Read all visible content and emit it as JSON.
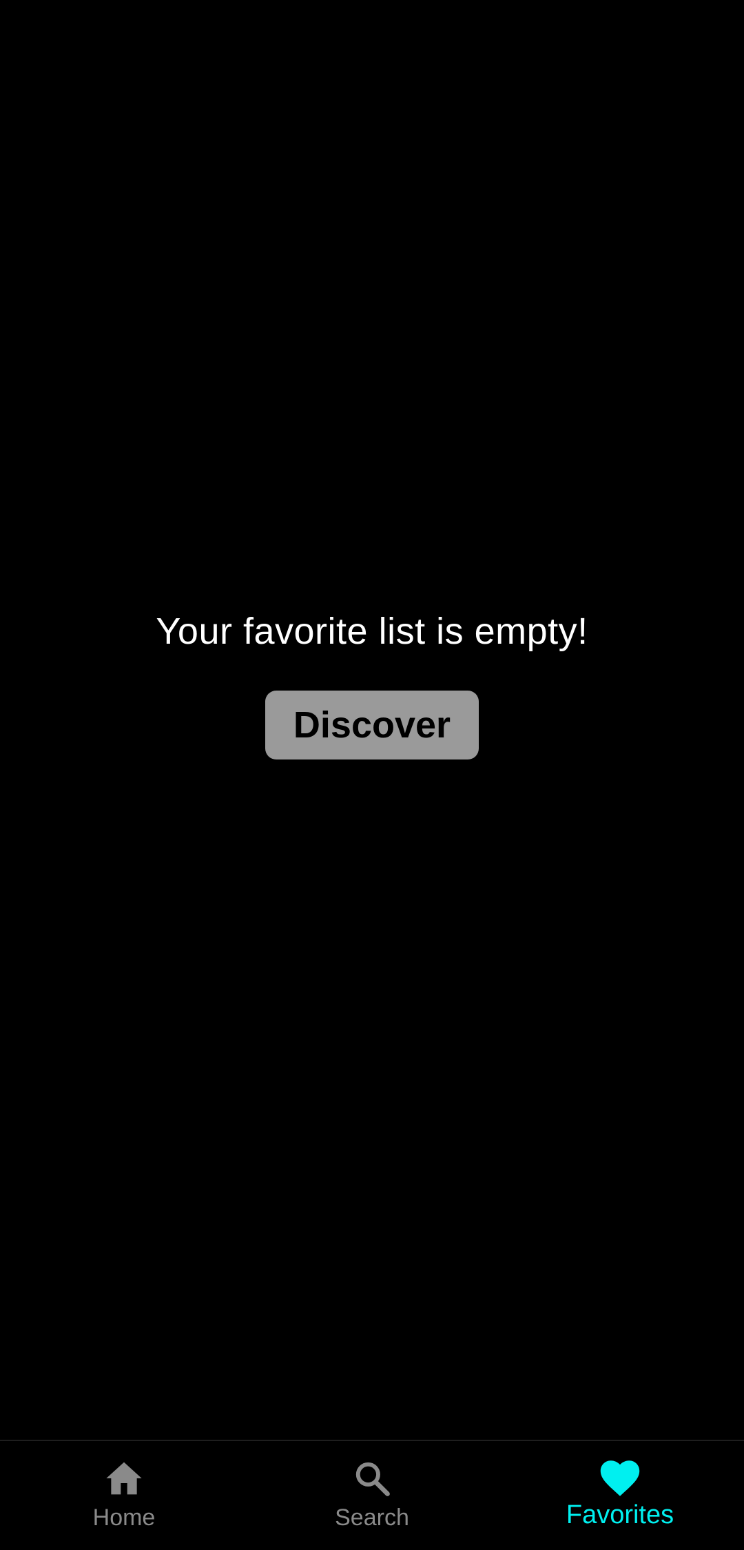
{
  "main": {
    "empty_message": "Your favorite list is empty!",
    "discover_label": "Discover"
  },
  "bottom_nav": {
    "items": [
      {
        "label": "Home",
        "icon": "home-icon",
        "active": false
      },
      {
        "label": "Search",
        "icon": "search-icon",
        "active": false
      },
      {
        "label": "Favorites",
        "icon": "heart-icon",
        "active": true
      }
    ]
  },
  "colors": {
    "background": "#000000",
    "accent": "#00f0f0",
    "inactive": "#8a8a8a",
    "button": "#9a9a9a"
  }
}
